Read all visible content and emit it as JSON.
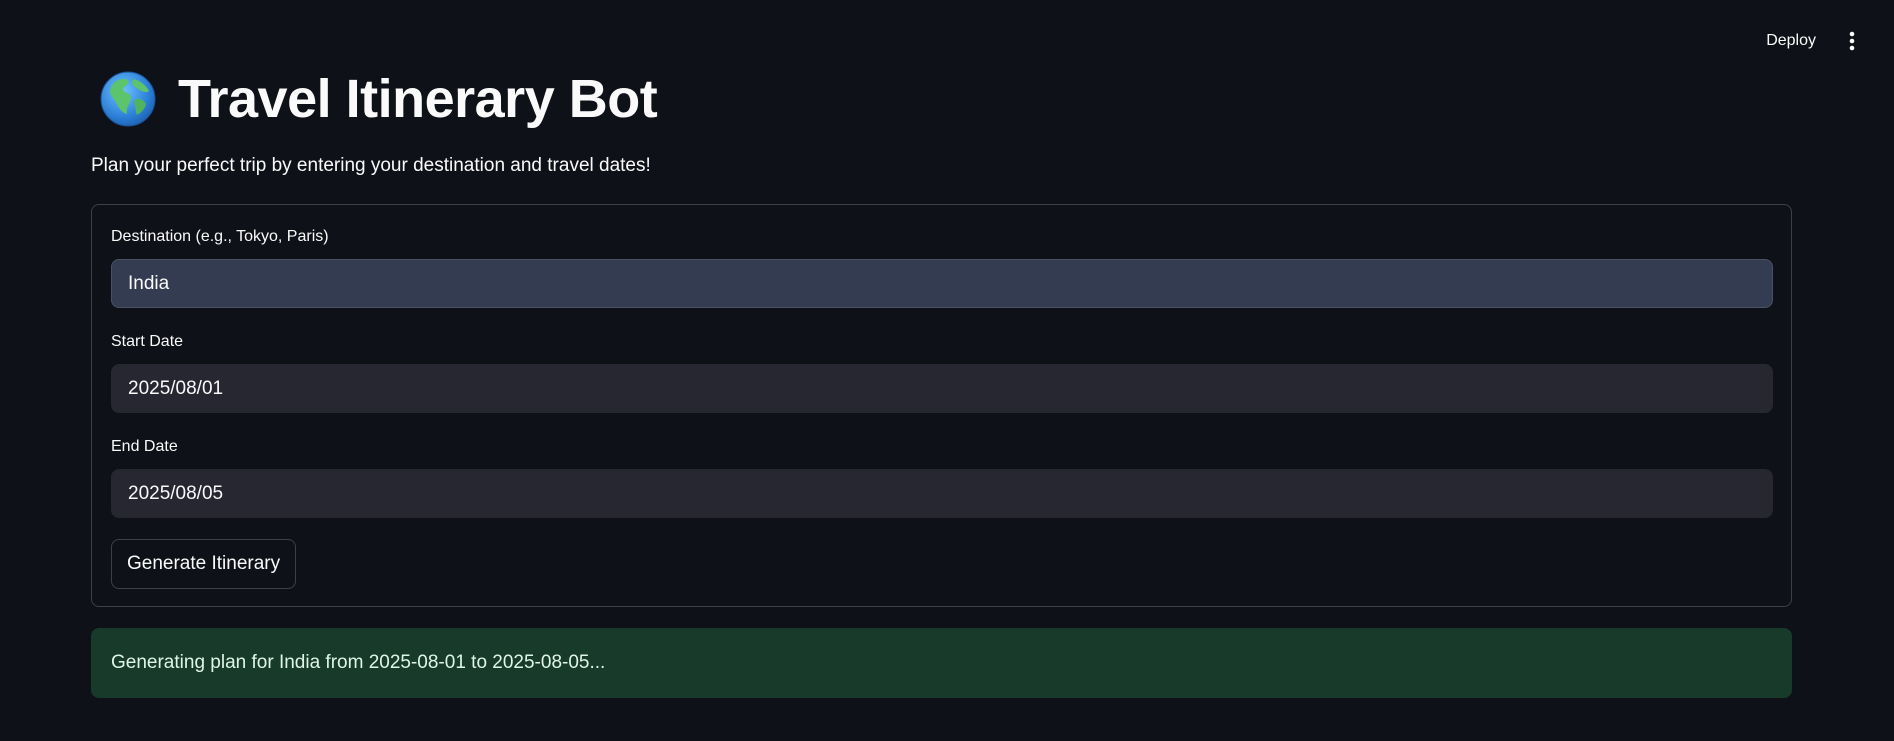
{
  "header": {
    "deploy_label": "Deploy",
    "menu_icon": "vertical-ellipsis-icon"
  },
  "page": {
    "title_icon": "globe-icon",
    "title": "Travel Itinerary Bot",
    "subtitle": "Plan your perfect trip by entering your destination and travel dates!"
  },
  "form": {
    "destination": {
      "label": "Destination (e.g., Tokyo, Paris)",
      "value": "India"
    },
    "start_date": {
      "label": "Start Date",
      "value": "2025/08/01"
    },
    "end_date": {
      "label": "End Date",
      "value": "2025/08/05"
    },
    "submit_label": "Generate Itinerary"
  },
  "status": {
    "message": "Generating plan for India from 2025-08-01 to 2025-08-05..."
  },
  "colors": {
    "background": "#0e1117",
    "destination_input_bg": "#343c52",
    "date_input_bg": "#262730",
    "success_alert_bg": "#183a2a"
  }
}
